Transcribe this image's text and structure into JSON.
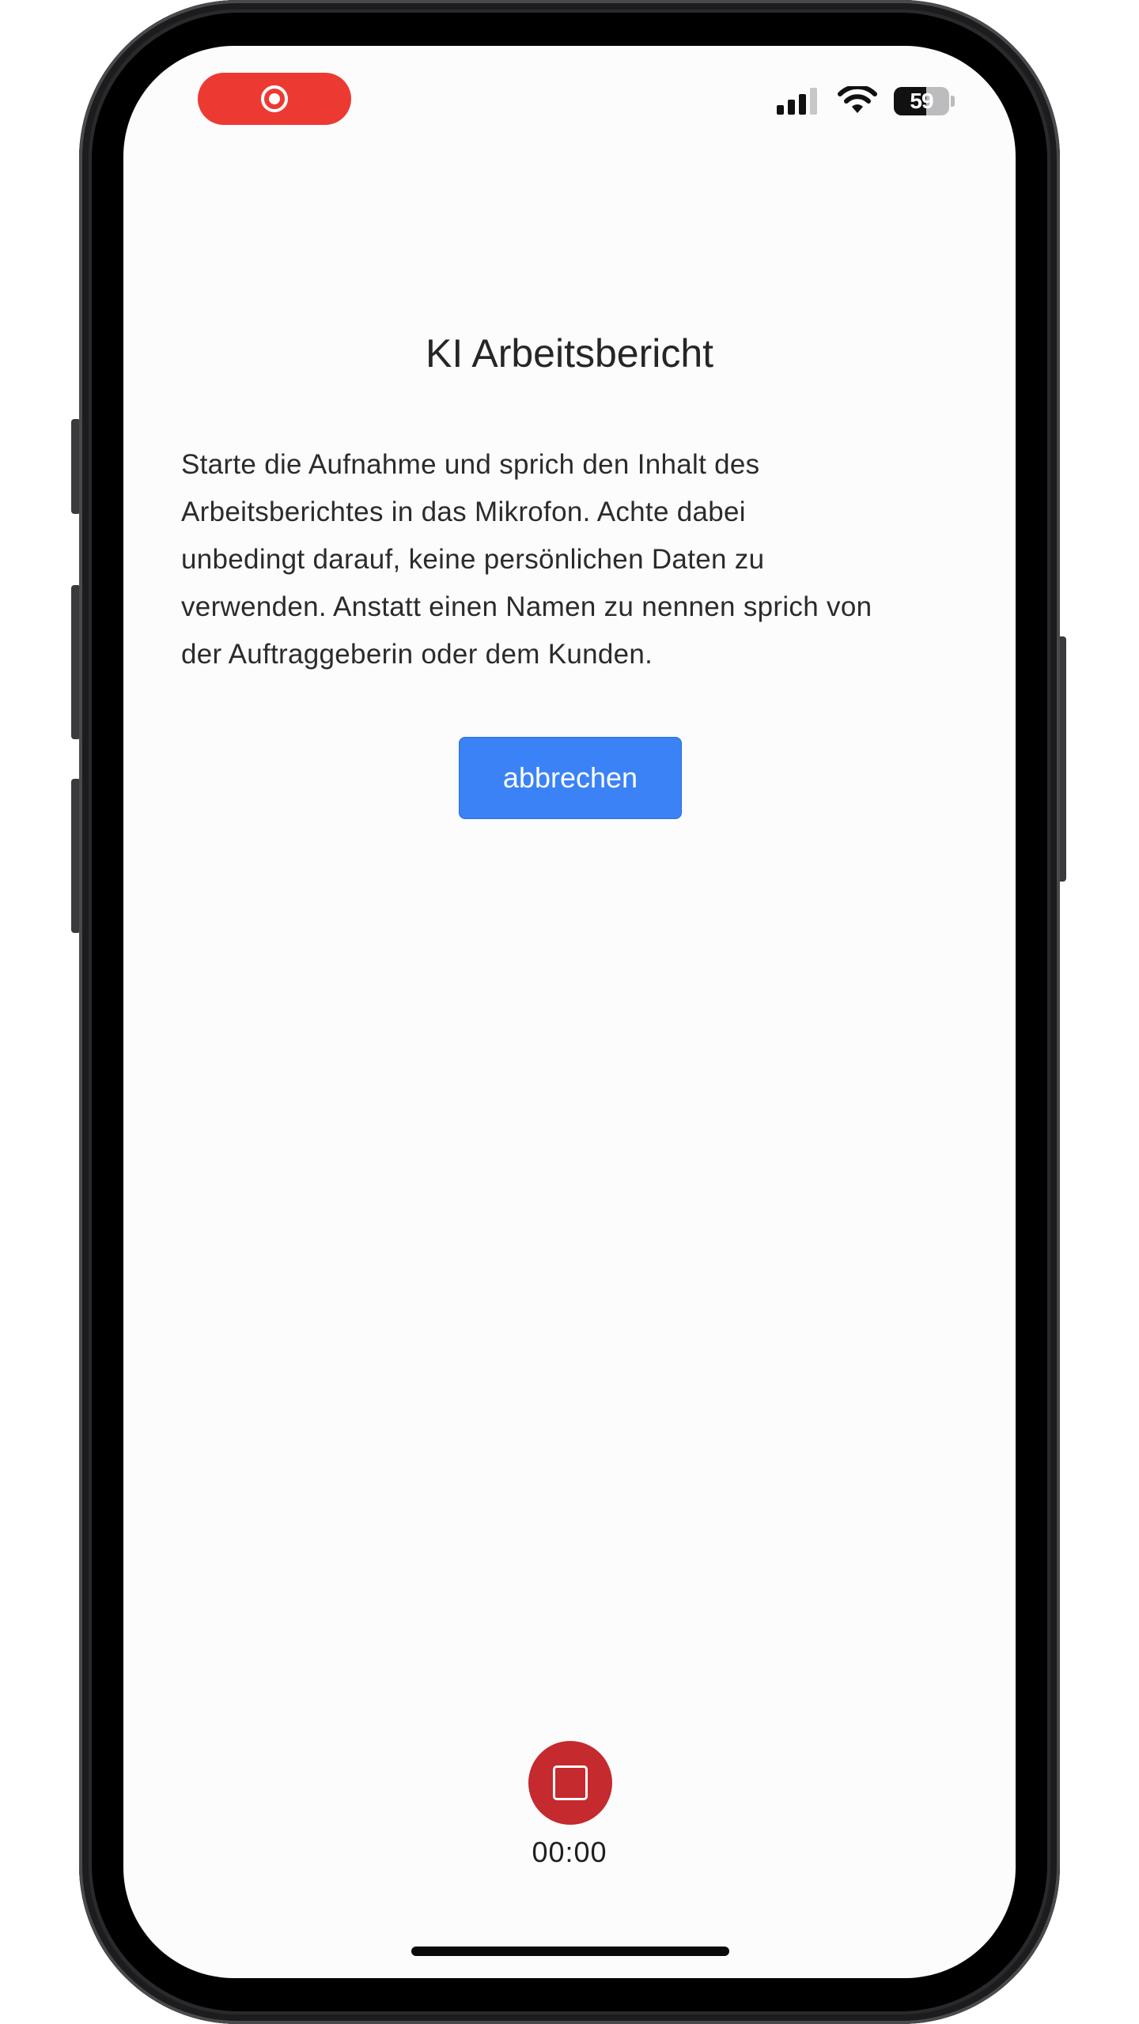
{
  "status_bar": {
    "battery_level": "59",
    "battery_fill_percent": 59
  },
  "main": {
    "title": "KI Arbeitsbericht",
    "description_lines": [
      "Starte die Aufnahme und sprich den Inhalt des",
      "Arbeitsberichtes in das Mikrofon. Achte dabei",
      "unbedingt darauf, keine persönlichen Daten zu",
      "verwenden. Anstatt einen Namen zu nennen sprich von",
      "der Auftraggeberin oder dem Kunden."
    ],
    "cancel_label": "abbrechen"
  },
  "recorder": {
    "timer": "00:00"
  },
  "icons": {
    "recording_indicator": "screen-record-icon",
    "signal": "cellular-signal-icon",
    "wifi": "wifi-icon",
    "battery": "battery-icon",
    "stop": "stop-icon"
  },
  "colors": {
    "recording_pill": "#ec3a33",
    "primary_button": "#3b82f6",
    "stop_button": "#c42a2e",
    "screen_background": "#fdfcfd"
  }
}
